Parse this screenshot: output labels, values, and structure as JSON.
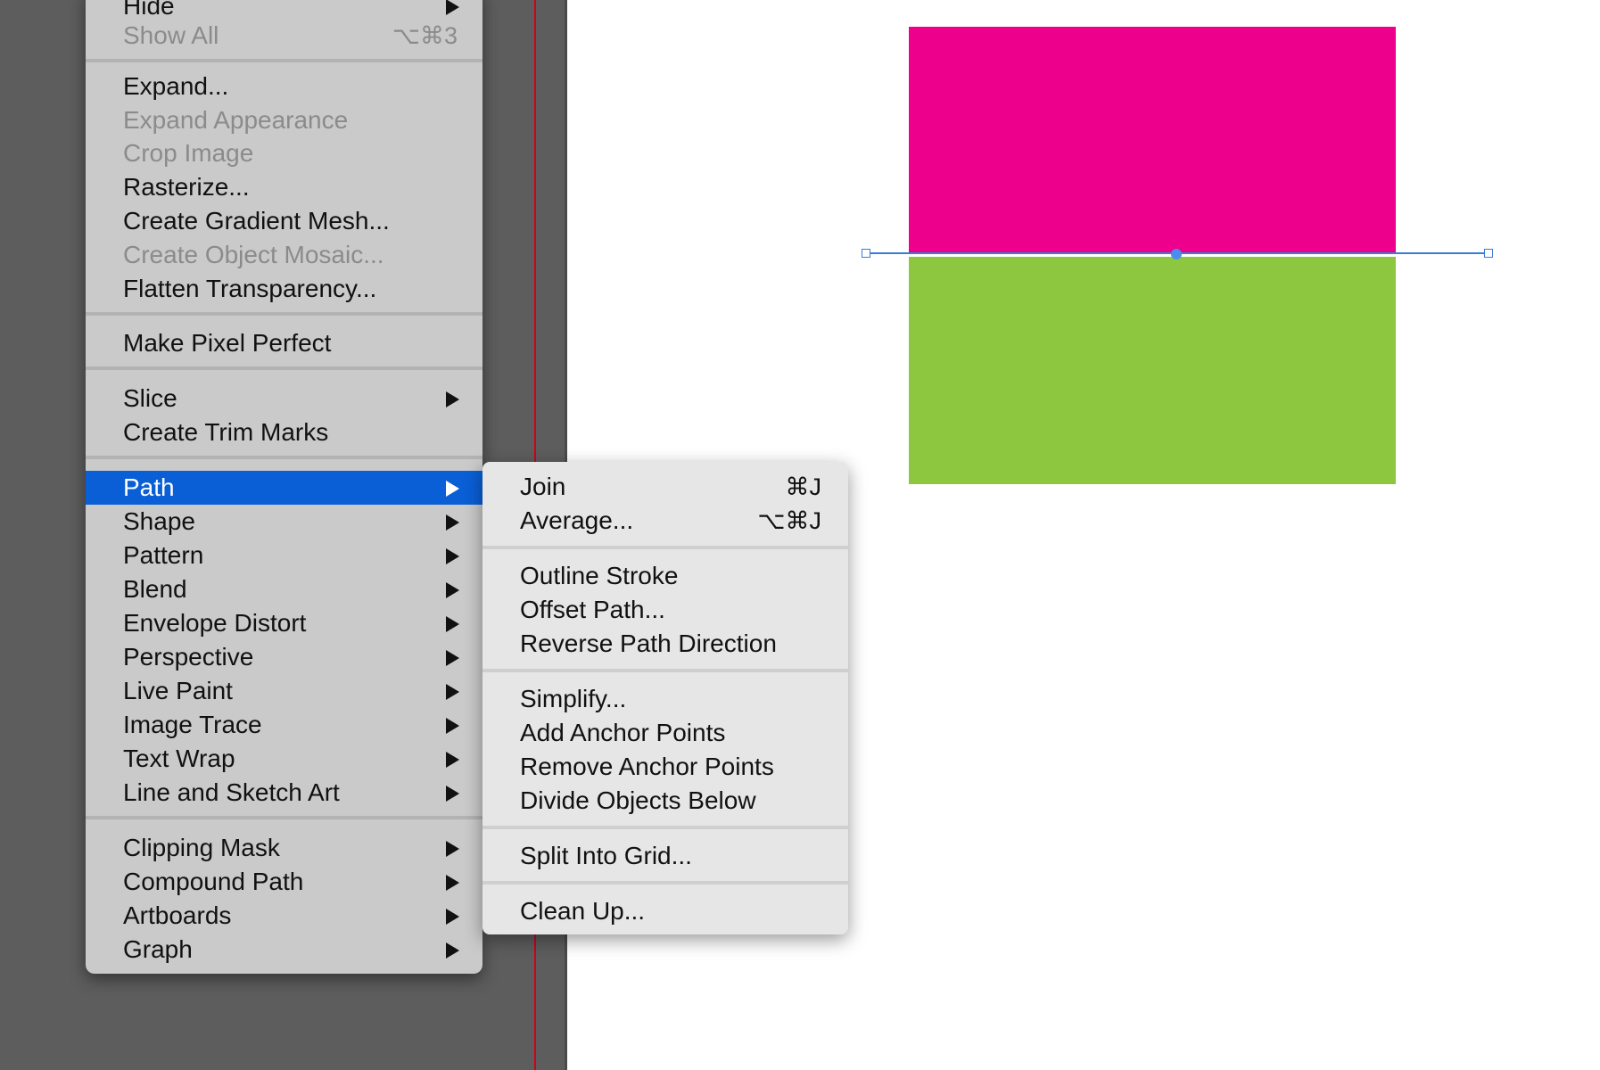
{
  "colors": {
    "magenta": "#EC008C",
    "green": "#8DC63F",
    "highlight": "#0A5FD6",
    "guide": "#D0021B"
  },
  "object_menu": {
    "items": [
      {
        "label": "Hide",
        "arrow": true,
        "disabled": false
      },
      {
        "label": "Show All",
        "shortcut": "⌥⌘3",
        "disabled": true
      },
      {
        "label": "Expand...",
        "disabled": false
      },
      {
        "label": "Expand Appearance",
        "disabled": true
      },
      {
        "label": "Crop Image",
        "disabled": true
      },
      {
        "label": "Rasterize...",
        "disabled": false
      },
      {
        "label": "Create Gradient Mesh...",
        "disabled": false
      },
      {
        "label": "Create Object Mosaic...",
        "disabled": true
      },
      {
        "label": "Flatten Transparency...",
        "disabled": false
      },
      {
        "label": "Make Pixel Perfect",
        "disabled": false
      },
      {
        "label": "Slice",
        "arrow": true
      },
      {
        "label": "Create Trim Marks"
      },
      {
        "label": "Path",
        "arrow": true,
        "highlighted": true
      },
      {
        "label": "Shape",
        "arrow": true
      },
      {
        "label": "Pattern",
        "arrow": true
      },
      {
        "label": "Blend",
        "arrow": true
      },
      {
        "label": "Envelope Distort",
        "arrow": true
      },
      {
        "label": "Perspective",
        "arrow": true
      },
      {
        "label": "Live Paint",
        "arrow": true
      },
      {
        "label": "Image Trace",
        "arrow": true
      },
      {
        "label": "Text Wrap",
        "arrow": true
      },
      {
        "label": "Line and Sketch Art",
        "arrow": true
      },
      {
        "label": "Clipping Mask",
        "arrow": true
      },
      {
        "label": "Compound Path",
        "arrow": true
      },
      {
        "label": "Artboards",
        "arrow": true
      },
      {
        "label": "Graph",
        "arrow": true
      }
    ]
  },
  "path_submenu": {
    "items": [
      {
        "label": "Join",
        "shortcut": "⌘J"
      },
      {
        "label": "Average...",
        "shortcut": "⌥⌘J"
      },
      {
        "label": "Outline Stroke"
      },
      {
        "label": "Offset Path..."
      },
      {
        "label": "Reverse Path Direction"
      },
      {
        "label": "Simplify..."
      },
      {
        "label": "Add Anchor Points"
      },
      {
        "label": "Remove Anchor Points"
      },
      {
        "label": "Divide Objects Below"
      },
      {
        "label": "Split Into Grid..."
      },
      {
        "label": "Clean Up..."
      }
    ]
  }
}
